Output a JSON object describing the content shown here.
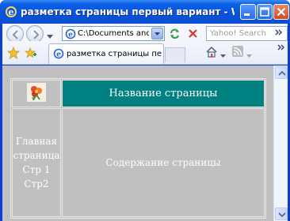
{
  "window": {
    "title": "разметка страницы первый вариант - Windows ..."
  },
  "address_bar": {
    "value": "C:\\Documents and Se"
  },
  "search": {
    "placeholder": "Yahoo! Search"
  },
  "tab": {
    "label": "разметка страницы перв..."
  },
  "page": {
    "header_text": "Название страницы",
    "nav_items": [
      {
        "label": "Главная"
      },
      {
        "label": "страница"
      },
      {
        "label": "Стр 1"
      },
      {
        "label": "Стр2"
      }
    ],
    "main_text": "Содержание страницы"
  },
  "colors": {
    "header_bg": "#008080",
    "page_bg": "#c0c0c0",
    "titlebar": "#0753dd"
  },
  "icons": {
    "title": "ie-icon",
    "logo": "flower-image",
    "favorites": "star-icon",
    "add_favorite": "add-favorite-icon",
    "home": "home-icon",
    "feeds": "rss-icon"
  }
}
